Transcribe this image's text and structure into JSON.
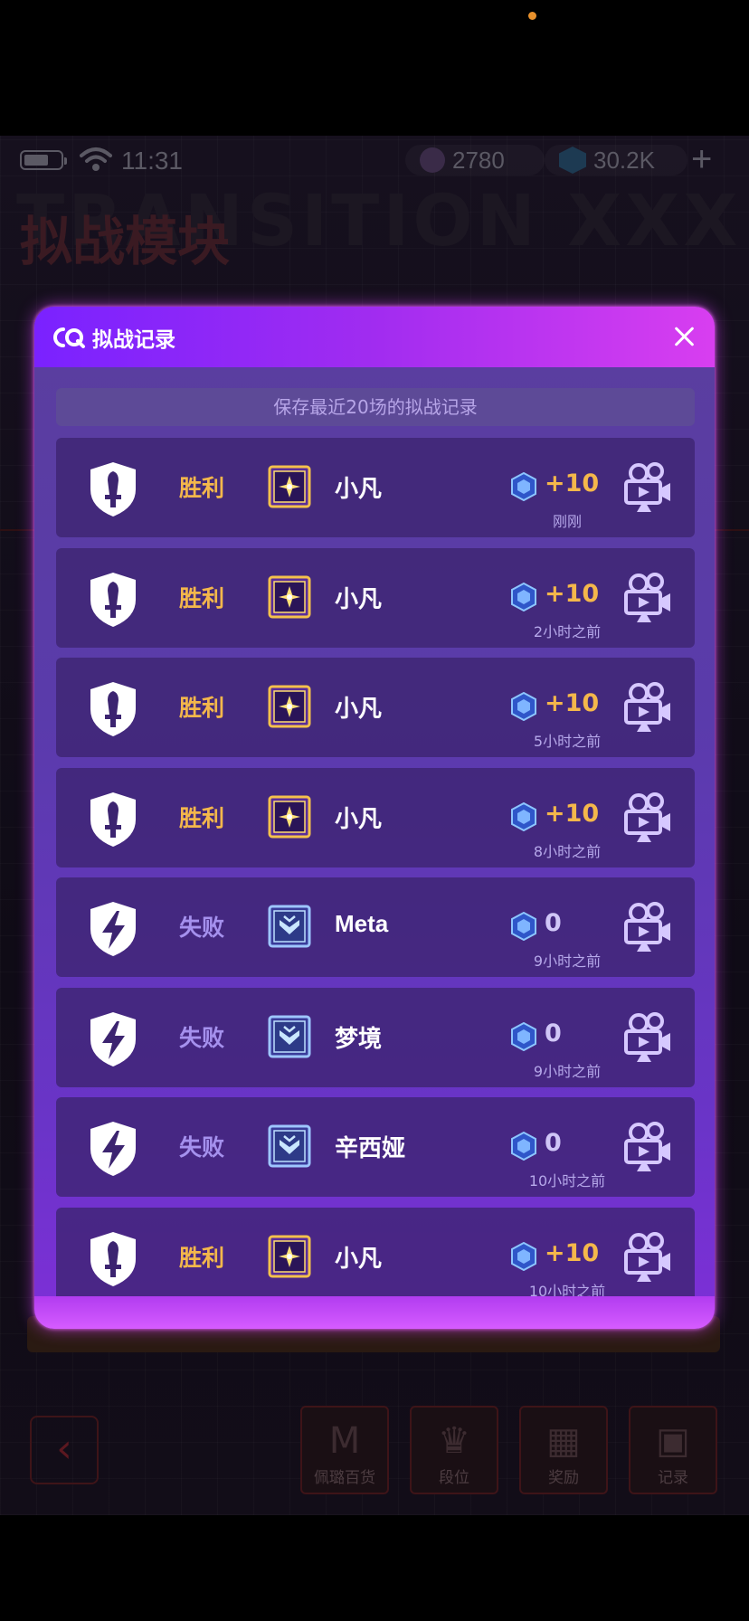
{
  "status_bar": {
    "time": "11:31",
    "coins": "2780",
    "gems": "30.2K"
  },
  "background": {
    "big_text": "TRANSITION XXX",
    "title": "拟战模块",
    "nav_labels": [
      "佩璐百货",
      "段位",
      "奖励",
      "记录"
    ]
  },
  "modal": {
    "title": "拟战记录",
    "subtitle": "保存最近20场的拟战记录",
    "records": [
      {
        "result": "胜利",
        "outcome": "win",
        "rank": "gold",
        "player": "小凡",
        "points": "+10",
        "time": "刚刚"
      },
      {
        "result": "胜利",
        "outcome": "win",
        "rank": "gold",
        "player": "小凡",
        "points": "+10",
        "time": "2小时之前"
      },
      {
        "result": "胜利",
        "outcome": "win",
        "rank": "gold",
        "player": "小凡",
        "points": "+10",
        "time": "5小时之前"
      },
      {
        "result": "胜利",
        "outcome": "win",
        "rank": "gold",
        "player": "小凡",
        "points": "+10",
        "time": "8小时之前"
      },
      {
        "result": "失败",
        "outcome": "lose",
        "rank": "blue",
        "player": "Meta",
        "points": "0",
        "time": "9小时之前"
      },
      {
        "result": "失败",
        "outcome": "lose",
        "rank": "blue",
        "player": "梦境",
        "points": "0",
        "time": "9小时之前"
      },
      {
        "result": "失败",
        "outcome": "lose",
        "rank": "blue",
        "player": "辛西娅",
        "points": "0",
        "time": "10小时之前"
      },
      {
        "result": "胜利",
        "outcome": "win",
        "rank": "gold",
        "player": "小凡",
        "points": "+10",
        "time": "10小时之前"
      }
    ]
  },
  "colors": {
    "win": "#f4b74b",
    "lose": "#a591ee",
    "header_start": "#7a22ff",
    "header_end": "#d83ef0"
  },
  "icons": {
    "win_result": "sword-shield-icon",
    "lose_result": "lightning-shield-icon",
    "rank": "rank-badge-icon",
    "points": "hex-gem-icon",
    "replay": "video-camera-icon"
  }
}
